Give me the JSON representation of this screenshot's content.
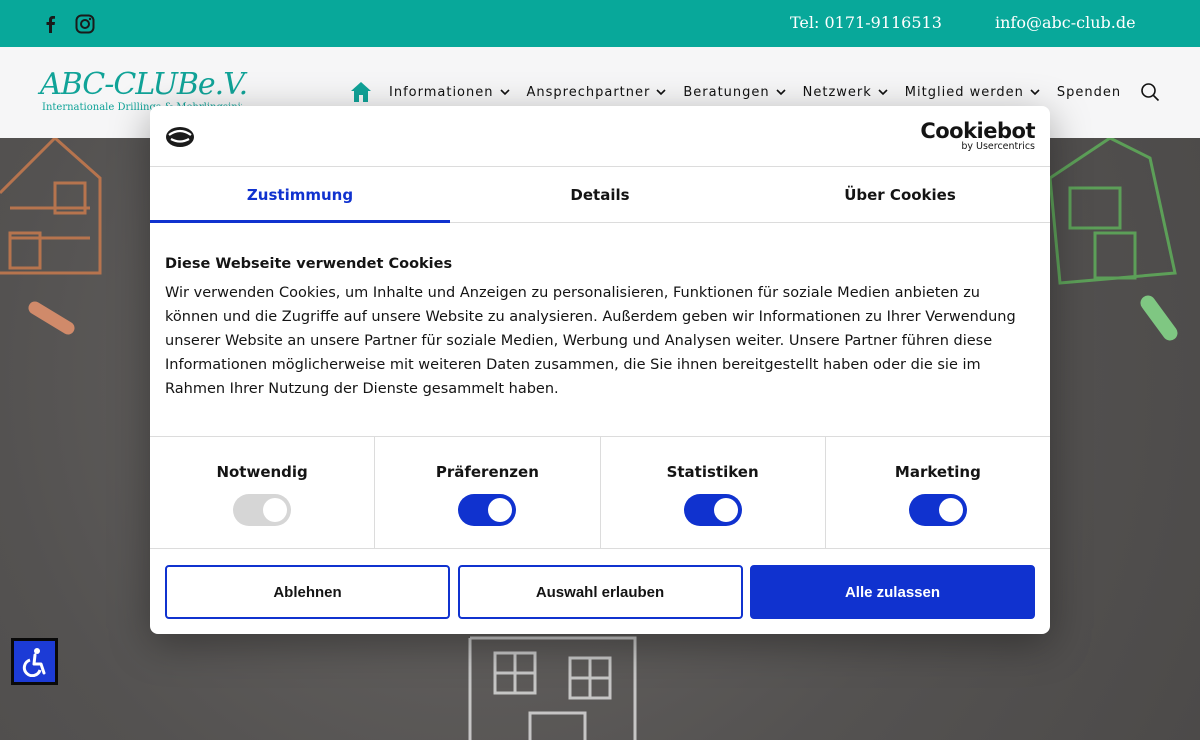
{
  "topbar": {
    "phone": "Tel: 0171-9116513",
    "email": "info@abc-club.de",
    "bg_color": "#08a89a"
  },
  "header": {
    "logo_text": "ABC-CLUBe.V.",
    "logo_subtitle": "Internationale Drillings & Mehrlingsinitiative",
    "nav": [
      {
        "label": "Informationen",
        "has_dropdown": true
      },
      {
        "label": "Ansprechpartner",
        "has_dropdown": true
      },
      {
        "label": "Beratungen",
        "has_dropdown": true
      },
      {
        "label": "Netzwerk",
        "has_dropdown": true
      },
      {
        "label": "Mitglied werden",
        "has_dropdown": true
      },
      {
        "label": "Spenden",
        "has_dropdown": false
      }
    ],
    "brand_color": "#11a398"
  },
  "dialog": {
    "brand_name": "Cookiebot",
    "brand_by": "by Usercentrics",
    "tabs": [
      {
        "label": "Zustimmung",
        "active": true
      },
      {
        "label": "Details",
        "active": false
      },
      {
        "label": "Über Cookies",
        "active": false
      }
    ],
    "heading": "Diese Webseite verwendet Cookies",
    "body": "Wir verwenden Cookies, um Inhalte und Anzeigen zu personalisieren, Funktionen für soziale Medien anbieten zu können und die Zugriffe auf unsere Website zu analysieren. Außerdem geben wir Informationen zu Ihrer Verwendung unserer Website an unsere Partner für soziale Medien, Werbung und Analysen weiter. Unsere Partner führen diese Informationen möglicherweise mit weiteren Daten zusammen, die Sie ihnen bereitgestellt haben oder die sie im Rahmen Ihrer Nutzung der Dienste gesammelt haben.",
    "categories": [
      {
        "label": "Notwendig",
        "checked": true,
        "disabled": true
      },
      {
        "label": "Präferenzen",
        "checked": true,
        "disabled": false
      },
      {
        "label": "Statistiken",
        "checked": true,
        "disabled": false
      },
      {
        "label": "Marketing",
        "checked": true,
        "disabled": false
      }
    ],
    "buttons": {
      "decline": "Ablehnen",
      "allow_selection": "Auswahl erlauben",
      "allow_all": "Alle zulassen"
    },
    "accent_color": "#1032cf"
  }
}
